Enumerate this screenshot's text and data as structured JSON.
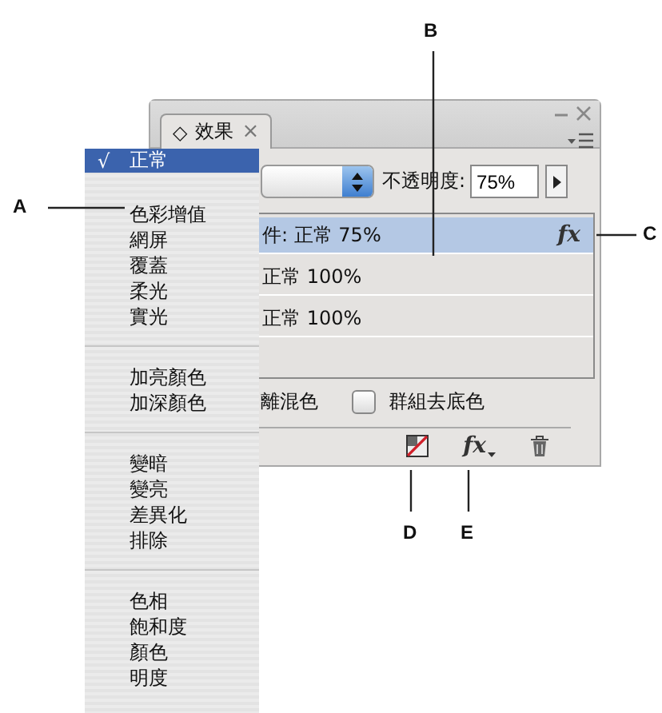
{
  "panel": {
    "tab": {
      "icon": "◇",
      "label": "效果",
      "close": "×"
    },
    "opacity_label": "不透明度:",
    "opacity_value": "75%",
    "rows": [
      {
        "label": "件: 正常 75%",
        "selected": true,
        "fx": "fx"
      },
      {
        "label": "正常 100%",
        "selected": false
      },
      {
        "label": "正常 100%",
        "selected": false
      }
    ],
    "options": [
      {
        "label": "離混色"
      },
      {
        "label": "群組去底色",
        "checked": false
      }
    ],
    "toolbar": {
      "fx_button": "fx"
    }
  },
  "menu": {
    "groups": [
      [
        {
          "label": "正常",
          "checked": true,
          "selected": true
        }
      ],
      [
        {
          "label": "色彩增值",
          "checked": false,
          "selected": false
        },
        {
          "label": "網屏",
          "checked": false,
          "selected": false
        },
        {
          "label": "覆蓋",
          "checked": false,
          "selected": false
        },
        {
          "label": "柔光",
          "checked": false,
          "selected": false
        },
        {
          "label": "實光",
          "checked": false,
          "selected": false
        }
      ],
      [
        {
          "label": "加亮顏色",
          "checked": false,
          "selected": false
        },
        {
          "label": "加深顏色",
          "checked": false,
          "selected": false
        }
      ],
      [
        {
          "label": "變暗",
          "checked": false,
          "selected": false
        },
        {
          "label": "變亮",
          "checked": false,
          "selected": false
        },
        {
          "label": "差異化",
          "checked": false,
          "selected": false
        },
        {
          "label": "排除",
          "checked": false,
          "selected": false
        }
      ],
      [
        {
          "label": "色相",
          "checked": false,
          "selected": false
        },
        {
          "label": "飽和度",
          "checked": false,
          "selected": false
        },
        {
          "label": "顏色",
          "checked": false,
          "selected": false
        },
        {
          "label": "明度",
          "checked": false,
          "selected": false
        }
      ]
    ],
    "check_mark": "√"
  },
  "callouts": [
    {
      "letter": "A"
    },
    {
      "letter": "B"
    },
    {
      "letter": "C"
    },
    {
      "letter": "D"
    },
    {
      "letter": "E"
    }
  ]
}
